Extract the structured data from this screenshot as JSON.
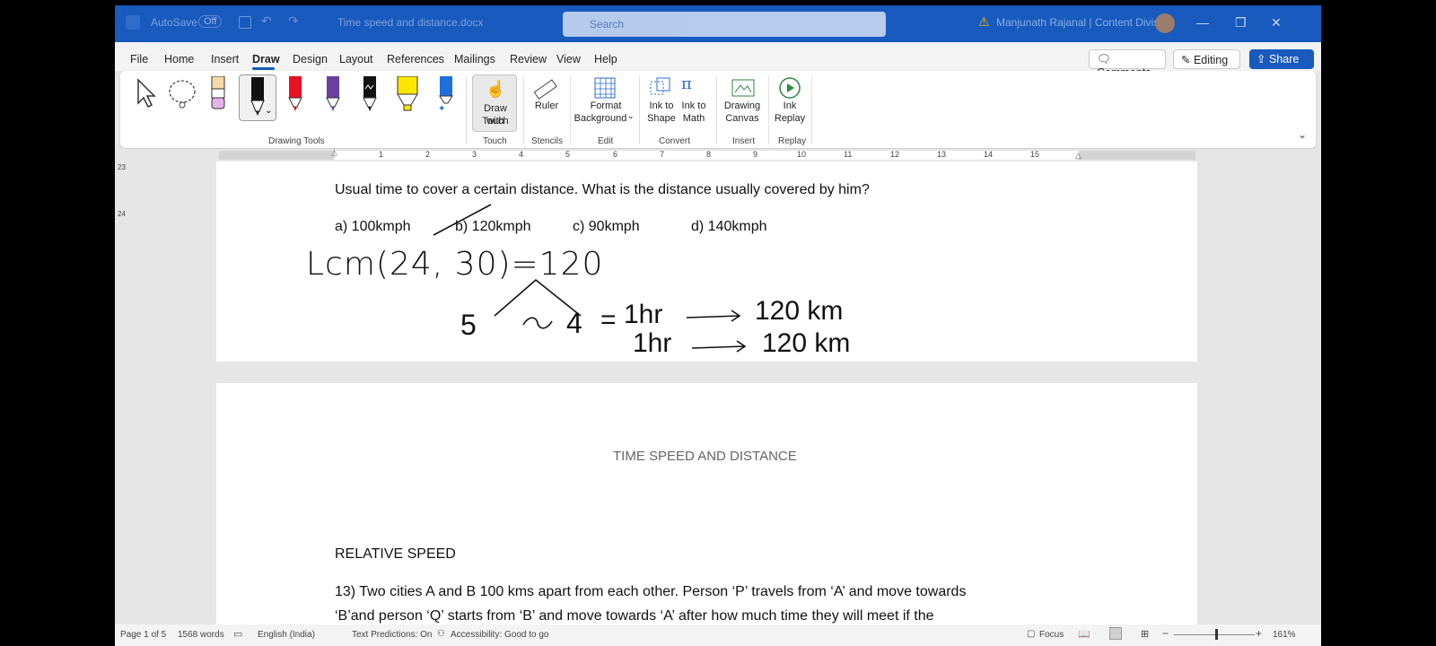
{
  "titlebar": {
    "autosave": "AutoSave",
    "autosave_state": "Off",
    "doc_title": "Time speed and distance.docx",
    "search_placeholder": "Search",
    "user": "Manjunath Rajanal | Content Division"
  },
  "tabs": [
    "File",
    "Home",
    "Insert",
    "Draw",
    "Design",
    "Layout",
    "References",
    "Mailings",
    "Review",
    "View",
    "Help"
  ],
  "actions": {
    "comments": "Comments",
    "editing": "Editing",
    "share": "Share"
  },
  "ribbon": {
    "groups": {
      "drawing_tools": "Drawing Tools",
      "touch": "Touch",
      "stencils": "Stencils",
      "edit": "Edit",
      "convert": "Convert",
      "insert": "Insert",
      "replay": "Replay"
    },
    "draw_with_touch": [
      "Draw with",
      "Touch"
    ],
    "ruler": "Ruler",
    "format_background": [
      "Format",
      "Background"
    ],
    "ink_to_shape": [
      "Ink to",
      "Shape"
    ],
    "ink_to_math": [
      "Ink to",
      "Math"
    ],
    "drawing_canvas": [
      "Drawing",
      "Canvas"
    ],
    "ink_replay": [
      "Ink",
      "Replay"
    ]
  },
  "ruler_numbers": [
    "1",
    "2",
    "3",
    "4",
    "5",
    "6",
    "7",
    "8",
    "9",
    "10",
    "11",
    "12",
    "13",
    "14",
    "15"
  ],
  "vruler_numbers": [
    "23",
    "24"
  ],
  "page1": {
    "question_tail": "Usual time to cover a certain distance. What is the distance usually covered by him?",
    "options": [
      "a) 100kmph",
      "b) 120kmph",
      "c) 90kmph",
      "d) 140kmph"
    ],
    "ink": {
      "lcm": "Lcm(24, 30)=120",
      "five": "5",
      "four": "4",
      "eq": "=",
      "hr1": "1hr",
      "hr2": "1hr",
      "km1": "120 km",
      "km2": "120 km"
    }
  },
  "page2": {
    "heading": "TIME SPEED AND DISTANCE",
    "section": "RELATIVE SPEED",
    "line1": "13) Two cities A and B 100 kms apart from each other. Person ‘P’ travels from ‘A’ and move towards",
    "line2": "‘B’and person ‘Q’ starts from ‘B’ and move towards ‘A’ after how much time they will meet if the"
  },
  "status": {
    "page": "Page 1 of 5",
    "words": "1568 words",
    "language": "English (India)",
    "predictions": "Text Predictions: On",
    "accessibility": "Accessibility: Good to go",
    "focus": "Focus",
    "zoom": "161%"
  },
  "colors": {
    "brand": "#185abd",
    "accent_red": "#e81123",
    "highlight_yellow": "#ffe600"
  }
}
